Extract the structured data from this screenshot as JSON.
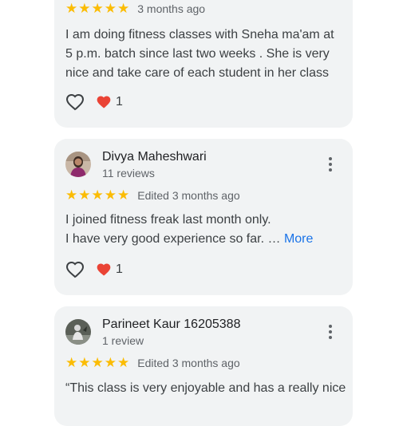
{
  "reviews": [
    {
      "time": "3 months ago",
      "lines": [
        "I am doing fitness classes with Sneha ma'am at",
        "5 p.m. batch since last two weeks . She is very",
        "nice and take care of each student in her class"
      ],
      "reaction_count": "1",
      "rating": 5
    },
    {
      "name": "Divya Maheshwari",
      "reviews_count": "11 reviews",
      "time": "Edited 3 months ago",
      "lines": [
        "I joined fitness freak last month only.",
        "I have very good experience so far. … "
      ],
      "more_label": "More",
      "reaction_count": "1",
      "rating": 5
    },
    {
      "name": "Parineet Kaur 16205388",
      "reviews_count": "1 review",
      "time": "Edited 3 months ago",
      "lines": [
        "“This class is very enjoyable and has a really nice"
      ],
      "rating": 5
    }
  ],
  "icons": {
    "star": "star-icon",
    "like": "heart-outline-icon",
    "reaction": "heart-filled-icon",
    "menu": "more-vert-icon"
  },
  "colors": {
    "star": "#fbbc04",
    "link": "#1a73e8",
    "reaction": "#ea4335",
    "card": "#f1f3f4"
  }
}
